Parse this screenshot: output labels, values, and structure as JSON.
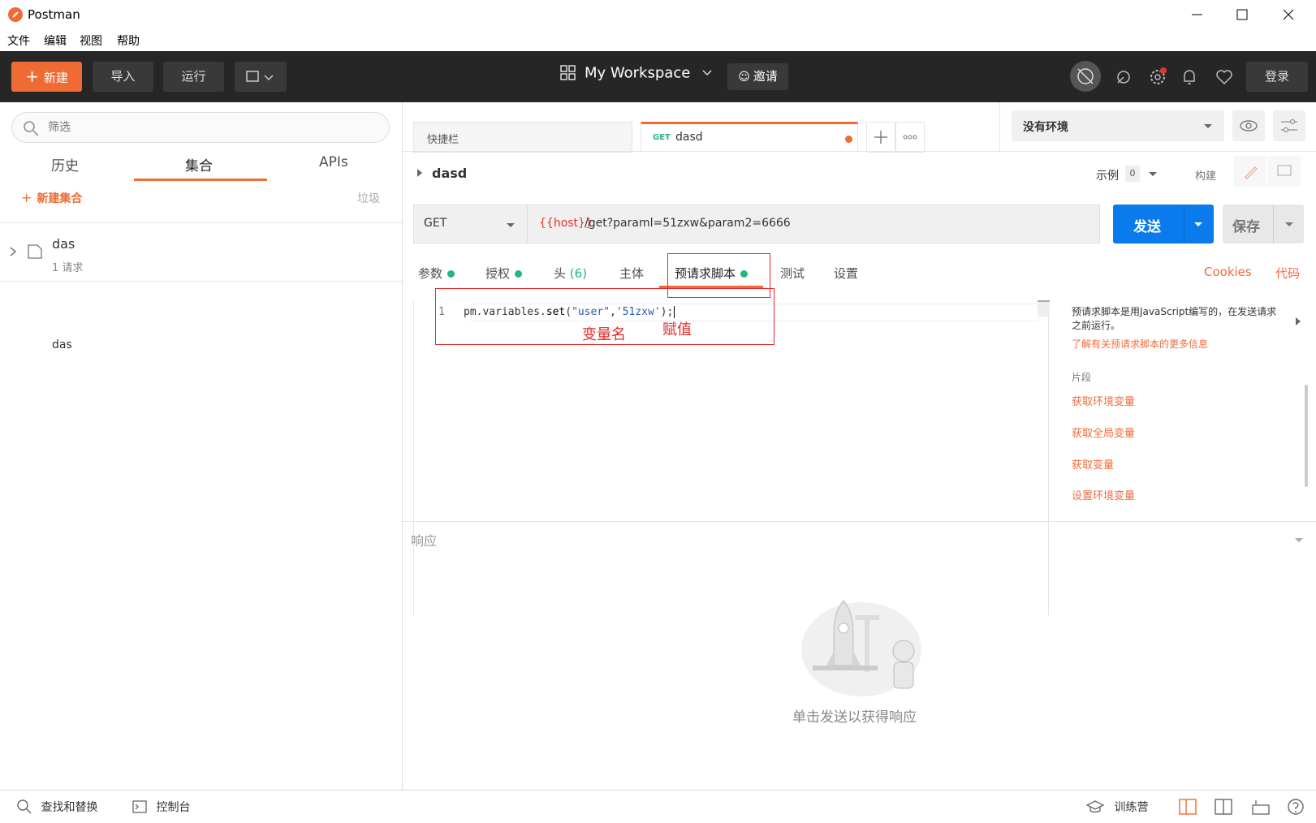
{
  "window": {
    "title": "Postman"
  },
  "menu": [
    "文件",
    "编辑",
    "视图",
    "帮助"
  ],
  "header": {
    "new_label": "新建",
    "import_label": "导入",
    "runner_label": "运行",
    "workspace_label": "My Workspace",
    "invite_label": "邀请",
    "signin_label": "登录"
  },
  "sidebar": {
    "filter_placeholder": "筛选",
    "tabs": [
      "历史",
      "集合",
      "APIs"
    ],
    "active_tab": "集合",
    "new_collection_label": "新建集合",
    "trash_label": "垃圾",
    "collections": [
      {
        "name": "das",
        "meta": "1 请求"
      }
    ]
  },
  "tabs": {
    "launchpad_label": "快捷栏",
    "request_tab_method": "GET",
    "request_tab_name": "dasd"
  },
  "environment": {
    "selected": "没有环境"
  },
  "request": {
    "name": "dasd",
    "examples_label": "示例",
    "examples_count": "0",
    "build_label": "构建",
    "method": "GET",
    "url_var": "{{host}}",
    "url_rest": "/get?paraml=51zxw&param2=6666",
    "send_label": "发送",
    "save_label": "保存"
  },
  "request_tabs": {
    "params": "参数",
    "auth": "授权",
    "headers": "头",
    "headers_count": "(6)",
    "body": "主体",
    "prerequest": "预请求脚本",
    "tests": "测试",
    "settings": "设置",
    "cookies": "Cookies",
    "code": "代码"
  },
  "editor": {
    "line_number": "1",
    "code_obj": "pm.variables.",
    "code_fn": "set",
    "code_open": "(",
    "code_arg1": "\"user\"",
    "code_comma": ",",
    "code_arg2": "'51zxw'",
    "code_close": ");"
  },
  "annotations": {
    "var_name": "变量名",
    "assign": "赋值"
  },
  "help": {
    "description": "预请求脚本是用JavaScript编写的，在发送请求之前运行。",
    "learn_more": "了解有关预请求脚本的更多信息",
    "snippets_title": "片段",
    "snippets": [
      "获取环境变量",
      "获取全局变量",
      "获取变量",
      "设置环境变量"
    ]
  },
  "response": {
    "title": "响应",
    "empty_text": "单击发送以获得响应"
  },
  "statusbar": {
    "find_replace": "查找和替换",
    "console": "控制台",
    "bootcamp": "训练营"
  },
  "colors": {
    "accent": "#ef6b33",
    "send_blue": "#097bed",
    "header_bg": "#262626",
    "annotation_red": "#e52a2a",
    "status_green": "#26b47f"
  }
}
